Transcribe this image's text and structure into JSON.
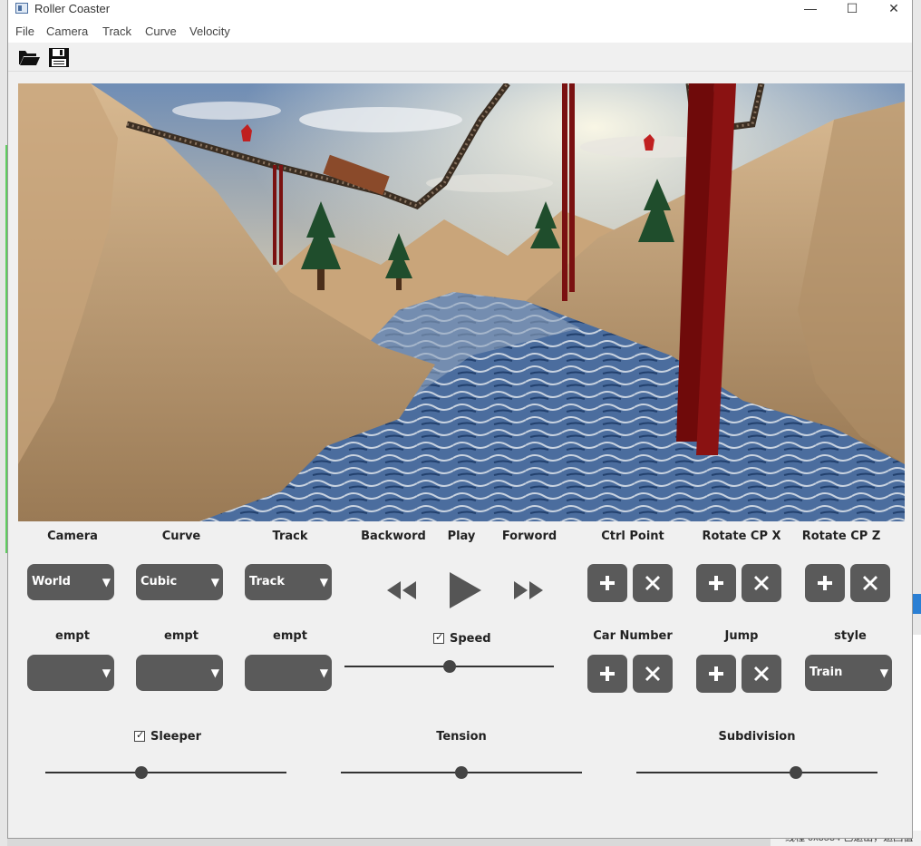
{
  "window": {
    "title": "Roller Coaster"
  },
  "menu": [
    "File",
    "Camera",
    "Track",
    "Curve",
    "Velocity"
  ],
  "toolbar": {
    "open_icon": "folder-open-icon",
    "save_icon": "save-icon"
  },
  "controls": {
    "camera": {
      "label": "Camera",
      "value": "World"
    },
    "curve": {
      "label": "Curve",
      "value": "Cubic"
    },
    "track": {
      "label": "Track",
      "value": "Track"
    },
    "empt1": {
      "label": "empt",
      "value": ""
    },
    "empt2": {
      "label": "empt",
      "value": ""
    },
    "empt3": {
      "label": "empt",
      "value": ""
    },
    "backword": "Backword",
    "play": "Play",
    "forword": "Forword",
    "ctrl_point": "Ctrl Point",
    "rotate_x": "Rotate CP X",
    "rotate_z": "Rotate CP Z",
    "car_number": "Car Number",
    "jump": "Jump",
    "style": {
      "label": "style",
      "value": "Train"
    },
    "speed": {
      "label": "Speed",
      "checked": true,
      "value": 0.5
    },
    "sleeper": {
      "label": "Sleeper",
      "checked": true,
      "value": 0.4
    },
    "tension": {
      "label": "Tension",
      "value": 0.5
    },
    "subdivision": {
      "label": "Subdivision",
      "value": 0.66
    }
  },
  "background": {
    "taskbar_text": "线程 0x3534 已退出，返回值"
  }
}
